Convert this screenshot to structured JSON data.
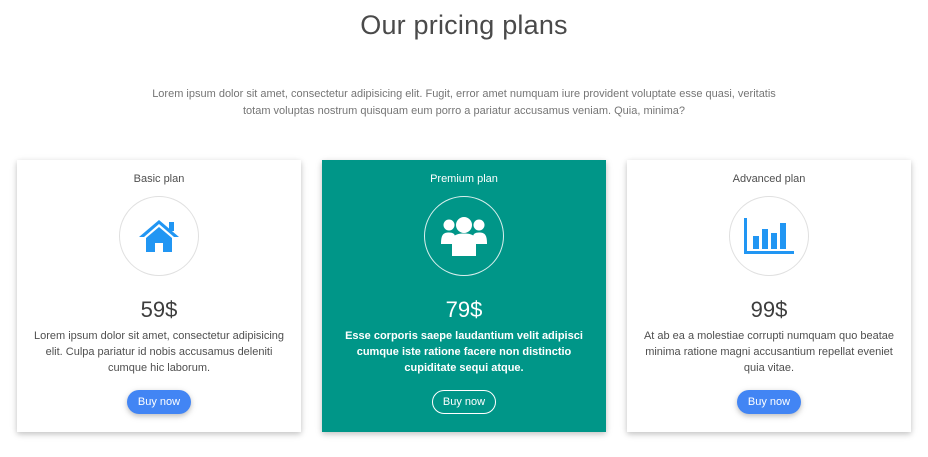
{
  "header": {
    "title": "Our pricing plans",
    "lead": "Lorem ipsum dolor sit amet, consectetur adipisicing elit. Fugit, error amet numquam iure provident voluptate esse quasi, veritatis totam voluptas nostrum quisquam eum porro a pariatur accusamus veniam. Quia, minima?"
  },
  "colors": {
    "accent": "#4285f4",
    "premium_bg": "#009688",
    "icon": "#2196f3"
  },
  "plans": [
    {
      "name": "Basic plan",
      "icon": "home-icon",
      "price": "59$",
      "description": "Lorem ipsum dolor sit amet, consectetur adipisicing elit. Culpa pariatur id nobis accusamus deleniti cumque hic laborum.",
      "button": "Buy now"
    },
    {
      "name": "Premium plan",
      "icon": "users-icon",
      "price": "79$",
      "description": "Esse corporis saepe laudantium velit adipisci cumque iste ratione facere non distinctio cupiditate sequi atque.",
      "button": "Buy now"
    },
    {
      "name": "Advanced plan",
      "icon": "bar-chart-icon",
      "price": "99$",
      "description": "At ab ea a molestiae corrupti numquam quo beatae minima ratione magni accusantium repellat eveniet quia vitae.",
      "button": "Buy now"
    }
  ]
}
